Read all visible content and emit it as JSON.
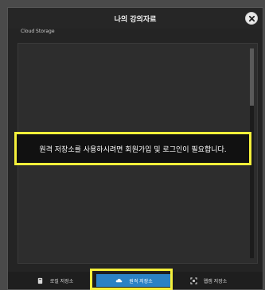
{
  "dialog": {
    "title": "나의 강의자료",
    "close_icon": "close-circle-icon"
  },
  "storage": {
    "section_label": "Cloud Storage",
    "notice": "원격 저장소를 사용하시려면 회원가입 및 로그인이 필요합니다."
  },
  "tabs": [
    {
      "label": "로컬 저장소",
      "icon": "device-icon"
    },
    {
      "label": "원격 저장소",
      "icon": "cloud-icon",
      "active": true
    },
    {
      "label": "웹캠 저장소",
      "icon": "scan-icon"
    }
  ],
  "colors": {
    "accent": "#2b82c4",
    "highlight": "#f5f03a"
  }
}
